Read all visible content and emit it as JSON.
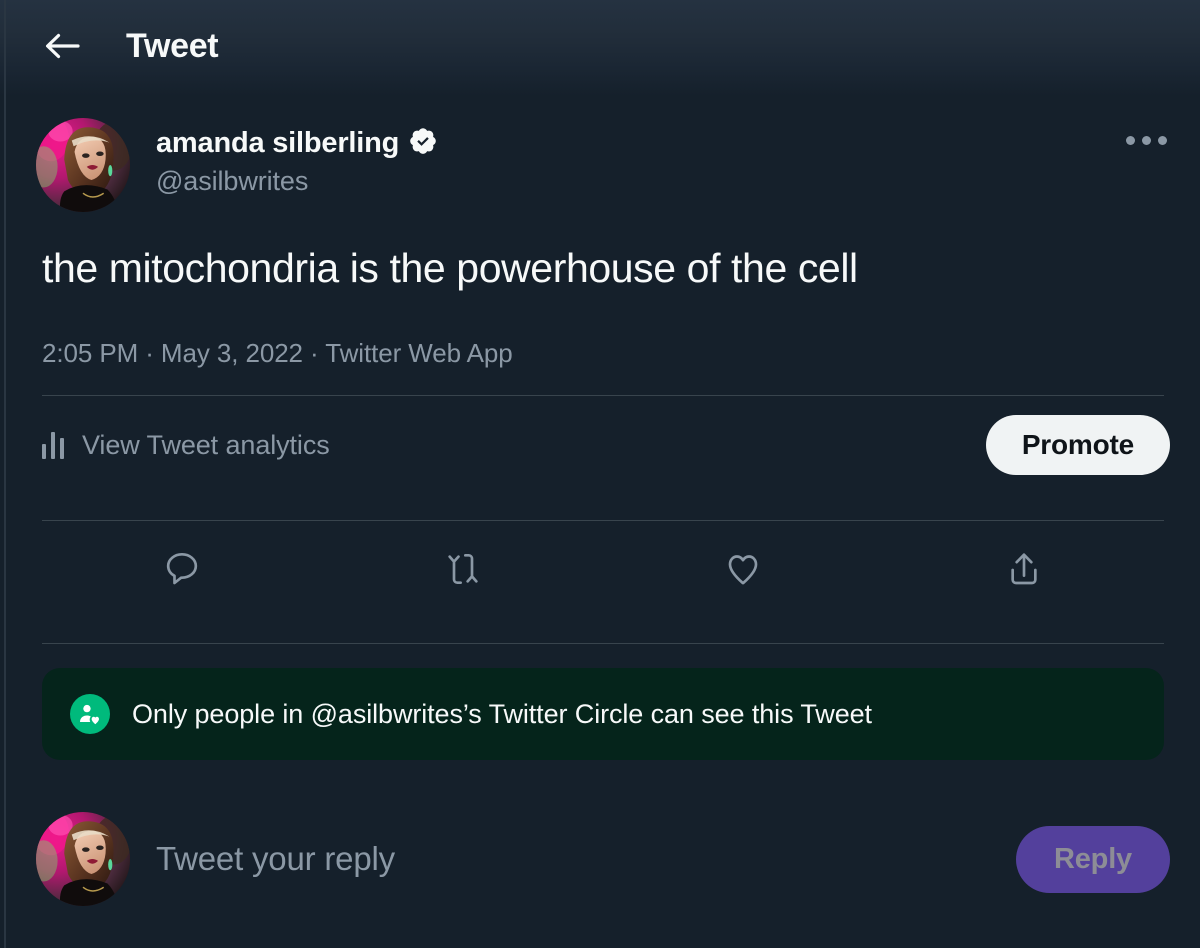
{
  "header": {
    "back_icon": "arrow-left-icon",
    "title": "Tweet"
  },
  "tweet": {
    "author": {
      "display_name": "amanda silberling",
      "handle": "@asilbwrites",
      "verified": true,
      "verified_icon": "verified-badge-icon",
      "avatar_icon": "user-avatar-photo"
    },
    "more_icon": "more-options-icon",
    "text": "the mitochondria is the powerhouse of the cell",
    "meta": "2:05 PM · May 3, 2022 · Twitter Web App",
    "analytics": {
      "icon": "bar-chart-icon",
      "label": "View Tweet analytics"
    },
    "promote_label": "Promote",
    "actions": [
      {
        "name": "reply-action",
        "icon": "comment-icon"
      },
      {
        "name": "retweet-action",
        "icon": "retweet-icon"
      },
      {
        "name": "like-action",
        "icon": "heart-icon"
      },
      {
        "name": "share-action",
        "icon": "share-icon"
      }
    ],
    "circle_notice": {
      "icon": "twitter-circle-icon",
      "text": "Only people in @asilbwrites’s Twitter Circle can see this Tweet"
    }
  },
  "composer": {
    "avatar_icon": "user-avatar-photo",
    "placeholder": "Tweet your reply",
    "reply_label": "Reply"
  },
  "colors": {
    "background": "#15202B",
    "text_primary": "#F7F9F9",
    "text_secondary": "#8B98A5",
    "divider": "#38444D",
    "promote_bg": "#F0F3F4",
    "promote_text": "#0F1419",
    "reply_bg": "#53409C",
    "reply_text": "#8D8D96",
    "circle_banner_bg": "#05241B",
    "circle_icon_bg": "#00BA7C"
  }
}
